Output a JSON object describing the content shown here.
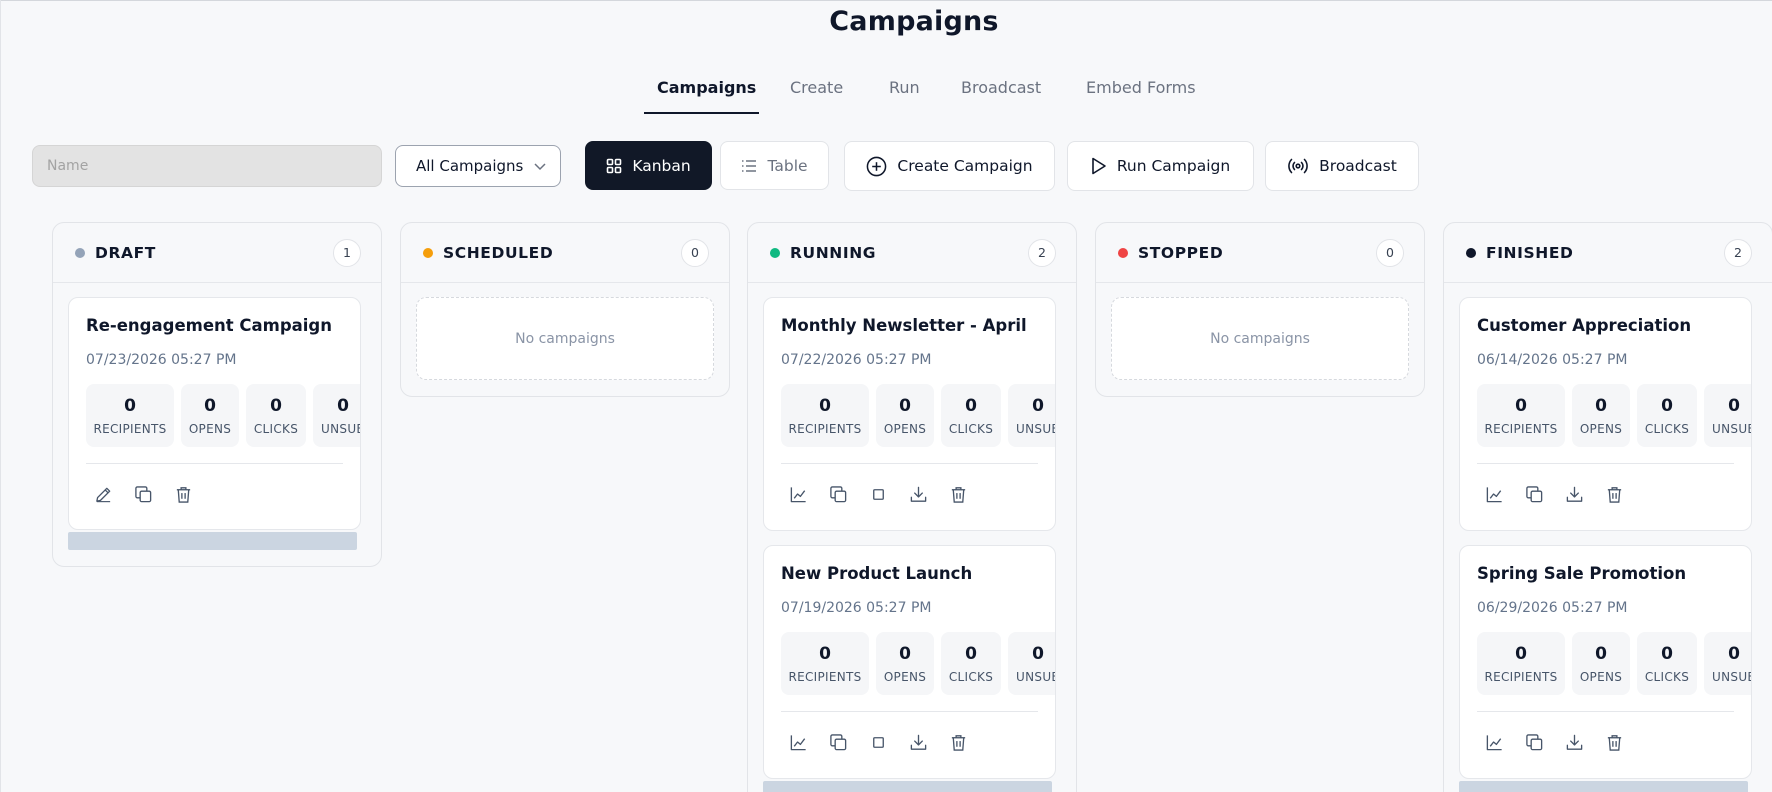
{
  "page": {
    "title": "Campaigns"
  },
  "tabs": [
    {
      "label": "Campaigns",
      "active": true
    },
    {
      "label": "Create"
    },
    {
      "label": "Run"
    },
    {
      "label": "Broadcast"
    },
    {
      "label": "Embed Forms"
    }
  ],
  "toolbar": {
    "search_placeholder": "Name",
    "filter_value": "All Campaigns",
    "kanban_label": "Kanban",
    "table_label": "Table",
    "create_label": "Create Campaign",
    "run_label": "Run Campaign",
    "broadcast_label": "Broadcast"
  },
  "stat_labels": {
    "recipients": "RECIPIENTS",
    "opens": "OPENS",
    "clicks": "CLICKS",
    "unsub": "UNSUB"
  },
  "columns": {
    "draft": {
      "title": "DRAFT",
      "count": "1",
      "color": "#94a3b8"
    },
    "scheduled": {
      "title": "SCHEDULED",
      "count": "0",
      "color": "#f59e0b",
      "empty_text": "No campaigns"
    },
    "running": {
      "title": "RUNNING",
      "count": "2",
      "color": "#10b981"
    },
    "stopped": {
      "title": "STOPPED",
      "count": "0",
      "color": "#ef4444",
      "empty_text": "No campaigns"
    },
    "finished": {
      "title": "FINISHED",
      "count": "2",
      "color": "#0f172a"
    }
  },
  "cards": {
    "reengagement": {
      "name": "Re-engagement Campaign",
      "date": "07/23/2026 05:27 PM",
      "recipients": "0",
      "opens": "0",
      "clicks": "0",
      "unsub": "0"
    },
    "newsletter": {
      "name": "Monthly Newsletter - April",
      "date": "07/22/2026 05:27 PM",
      "recipients": "0",
      "opens": "0",
      "clicks": "0",
      "unsub": "0"
    },
    "launch": {
      "name": "New Product Launch",
      "date": "07/19/2026 05:27 PM",
      "recipients": "0",
      "opens": "0",
      "clicks": "0",
      "unsub": "0"
    },
    "appreciation": {
      "name": "Customer Appreciation",
      "date": "06/14/2026 05:27 PM",
      "recipients": "0",
      "opens": "0",
      "clicks": "0",
      "unsub": "0"
    },
    "spring": {
      "name": "Spring Sale Promotion",
      "date": "06/29/2026 05:27 PM",
      "recipients": "0",
      "opens": "0",
      "clicks": "0",
      "unsub": "0"
    }
  }
}
